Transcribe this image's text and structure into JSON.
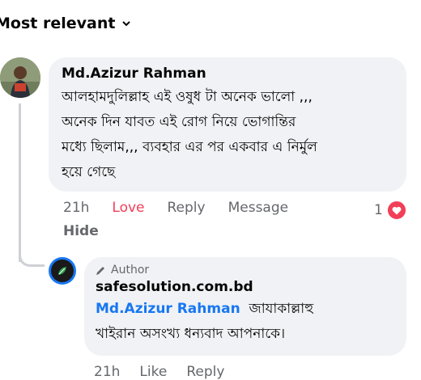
{
  "sort": {
    "label": "Most relevant"
  },
  "comment": {
    "author": "Md.Azizur Rahman",
    "text": "আলহামদুলিল্লাহ এই ওষুধ টা অনেক ভালো ,,,\nঅনেক দিন যাবত এই রোগ নিয়ে ভোগান্তির\nমধ্যে ছিলাম,,, ব্যবহার এর পর একবার এ নির্মুল\nহয়ে গেছে",
    "time": "21h",
    "love_label": "Love",
    "reply_label": "Reply",
    "message_label": "Message",
    "hide_label": "Hide",
    "reaction_count": "1",
    "reaction_icon": "heart-icon",
    "love_color": "#f33e58"
  },
  "reply": {
    "badge": "Author",
    "author": "safesolution.com.bd",
    "mention": "Md.Azizur Rahman",
    "text_after_mention": "জাযাকাল্লাহু",
    "text_line2": "খাইরান অসংখ্য ধন্যবাদ আপনাকে।",
    "time": "21h",
    "like_label": "Like",
    "reply_label": "Reply",
    "mention_color": "#1877f2"
  }
}
